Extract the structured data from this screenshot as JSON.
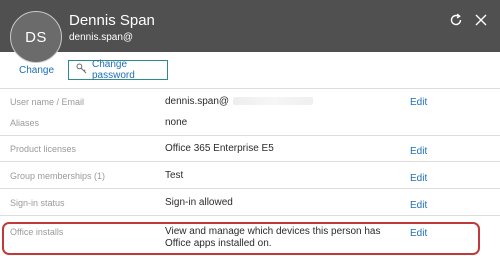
{
  "header": {
    "avatar_initials": "DS",
    "user_name": "Dennis Span",
    "user_email": "dennis.span@",
    "refresh_icon": "refresh-icon",
    "close_icon": "close-icon"
  },
  "actions": {
    "change_label": "Change",
    "change_password_label": "Change password",
    "password_icon": "key-icon"
  },
  "rows": [
    {
      "label": "User name / Email",
      "value": "dennis.span@",
      "edit": "Edit"
    },
    {
      "label": "Aliases",
      "value": "none"
    },
    {
      "label": "Product licenses",
      "value": "Office 365 Enterprise E5",
      "edit": "Edit"
    },
    {
      "label": "Group memberships (1)",
      "value": "Test",
      "edit": "Edit"
    },
    {
      "label": "Sign-in status",
      "value": "Sign-in allowed",
      "edit": "Edit"
    },
    {
      "label": "Office installs",
      "value": "View and manage which devices this person has Office apps installed on.",
      "edit": "Edit"
    }
  ],
  "colors": {
    "header_bg": "#505050",
    "link": "#1d6fb8",
    "highlight": "#c0393b"
  }
}
